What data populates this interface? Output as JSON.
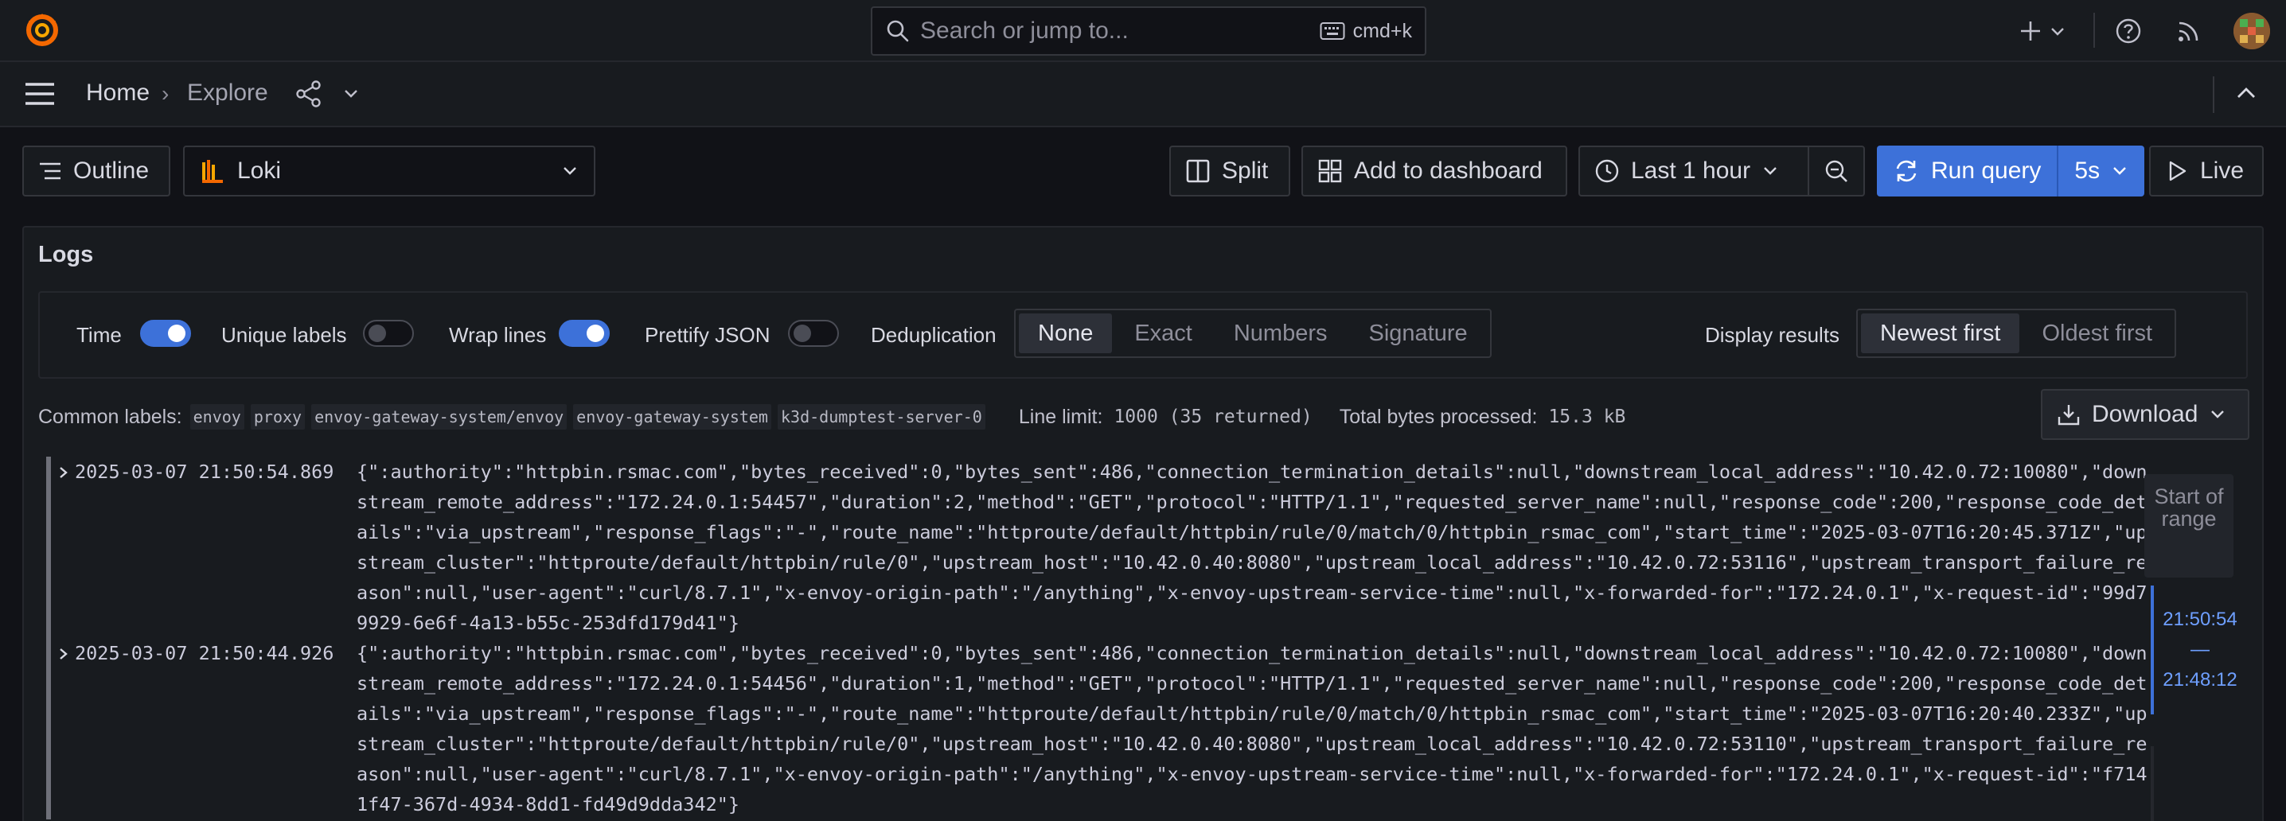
{
  "topbar": {
    "search_placeholder": "Search or jump to...",
    "search_shortcut": "cmd+k"
  },
  "breadcrumb": {
    "home": "Home",
    "separator": "›",
    "current": "Explore"
  },
  "toolbar": {
    "outline_label": "Outline",
    "datasource": "Loki",
    "split_label": "Split",
    "add_to_dashboard_label": "Add to dashboard",
    "time_range": "Last 1 hour",
    "run_query_label": "Run query",
    "refresh_interval": "5s",
    "live_label": "Live"
  },
  "logs_panel": {
    "title": "Logs",
    "options": {
      "time_label": "Time",
      "time_on": true,
      "unique_labels_label": "Unique labels",
      "unique_labels_on": false,
      "wrap_lines_label": "Wrap lines",
      "wrap_lines_on": true,
      "prettify_json_label": "Prettify JSON",
      "prettify_json_on": false,
      "dedup_label": "Deduplication",
      "dedup_options": [
        "None",
        "Exact",
        "Numbers",
        "Signature"
      ],
      "dedup_selected": "None",
      "display_results_label": "Display results",
      "display_options": [
        "Newest first",
        "Oldest first"
      ],
      "display_selected": "Newest first"
    },
    "common_labels_label": "Common labels:",
    "common_labels": [
      "envoy",
      "proxy",
      "envoy-gateway-system/envoy",
      "envoy-gateway-system",
      "k3d-dumptest-server-0"
    ],
    "line_limit_label": "Line limit:",
    "line_limit_value": "1000 (35 returned)",
    "bytes_label": "Total bytes processed:",
    "bytes_value": "15.3 kB",
    "download_label": "Download",
    "rows": [
      {
        "timestamp": "2025-03-07 21:50:54.869",
        "line": "{\":authority\":\"httpbin.rsmac.com\",\"bytes_received\":0,\"bytes_sent\":486,\"connection_termination_details\":null,\"downstream_local_address\":\"10.42.0.72:10080\",\"downstream_remote_address\":\"172.24.0.1:54457\",\"duration\":2,\"method\":\"GET\",\"protocol\":\"HTTP/1.1\",\"requested_server_name\":null,\"response_code\":200,\"response_code_details\":\"via_upstream\",\"response_flags\":\"-\",\"route_name\":\"httproute/default/httpbin/rule/0/match/0/httpbin_rsmac_com\",\"start_time\":\"2025-03-07T16:20:45.371Z\",\"upstream_cluster\":\"httproute/default/httpbin/rule/0\",\"upstream_host\":\"10.42.0.40:8080\",\"upstream_local_address\":\"10.42.0.72:53116\",\"upstream_transport_failure_reason\":null,\"user-agent\":\"curl/8.7.1\",\"x-envoy-origin-path\":\"/anything\",\"x-envoy-upstream-service-time\":null,\"x-forwarded-for\":\"172.24.0.1\",\"x-request-id\":\"99d79929-6e6f-4a13-b55c-253dfd179d41\"}"
      },
      {
        "timestamp": "2025-03-07 21:50:44.926",
        "line": "{\":authority\":\"httpbin.rsmac.com\",\"bytes_received\":0,\"bytes_sent\":486,\"connection_termination_details\":null,\"downstream_local_address\":\"10.42.0.72:10080\",\"downstream_remote_address\":\"172.24.0.1:54456\",\"duration\":1,\"method\":\"GET\",\"protocol\":\"HTTP/1.1\",\"requested_server_name\":null,\"response_code\":200,\"response_code_details\":\"via_upstream\",\"response_flags\":\"-\",\"route_name\":\"httproute/default/httpbin/rule/0/match/0/httpbin_rsmac_com\",\"start_time\":\"2025-03-07T16:20:40.233Z\",\"upstream_cluster\":\"httproute/default/httpbin/rule/0\",\"upstream_host\":\"10.42.0.40:8080\",\"upstream_local_address\":\"10.42.0.72:53110\",\"upstream_transport_failure_reason\":null,\"user-agent\":\"curl/8.7.1\",\"x-envoy-origin-path\":\"/anything\",\"x-envoy-upstream-service-time\":null,\"x-forwarded-for\":\"172.24.0.1\",\"x-request-id\":\"f7141f47-367d-4934-8dd1-fd49d9dda342\"}"
      }
    ],
    "range_navigator": {
      "start_label": "Start of range",
      "to_time": "21:50:54",
      "dash": "—",
      "from_time": "21:48:12"
    }
  },
  "colors": {
    "accent": "#3d71d9",
    "background": "#111217",
    "panel": "#181b1f"
  },
  "icons": [
    "grafana-logo-icon",
    "search-icon",
    "keyboard-icon",
    "plus-icon",
    "help-icon",
    "rss-icon",
    "menu-icon",
    "share-icon",
    "outline-icon",
    "loki-icon",
    "split-icon",
    "dashboard-icon",
    "clock-icon",
    "zoom-out-icon",
    "refresh-icon",
    "play-icon",
    "download-icon",
    "chevron-down-icon",
    "chevron-up-icon",
    "chevron-right-icon"
  ]
}
